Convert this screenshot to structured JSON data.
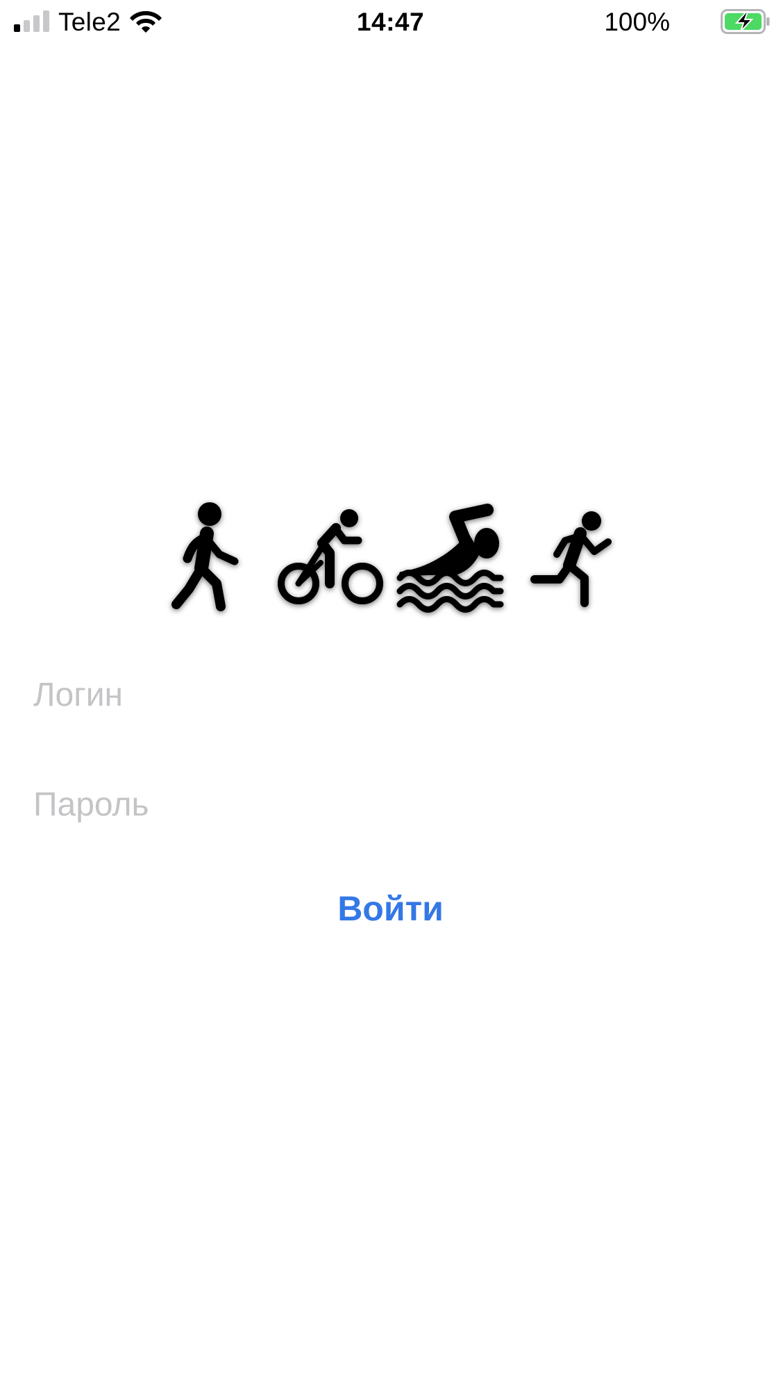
{
  "status_bar": {
    "carrier": "Tele2",
    "time": "14:47",
    "battery_percent": "100%",
    "signal_bars_active": 1,
    "signal_bars_total": 4,
    "battery_level": 1.0,
    "battery_charging": true,
    "battery_color": "#4cd964"
  },
  "sports": {
    "icons": [
      "walking-icon",
      "cycling-icon",
      "swimming-icon",
      "running-icon"
    ]
  },
  "form": {
    "login_placeholder": "Логин",
    "password_placeholder": "Пароль",
    "login_value": "",
    "password_value": "",
    "submit_label": "Войти"
  },
  "colors": {
    "accent": "#3478e6",
    "placeholder": "#c4c4c7",
    "background": "#ffffff"
  }
}
